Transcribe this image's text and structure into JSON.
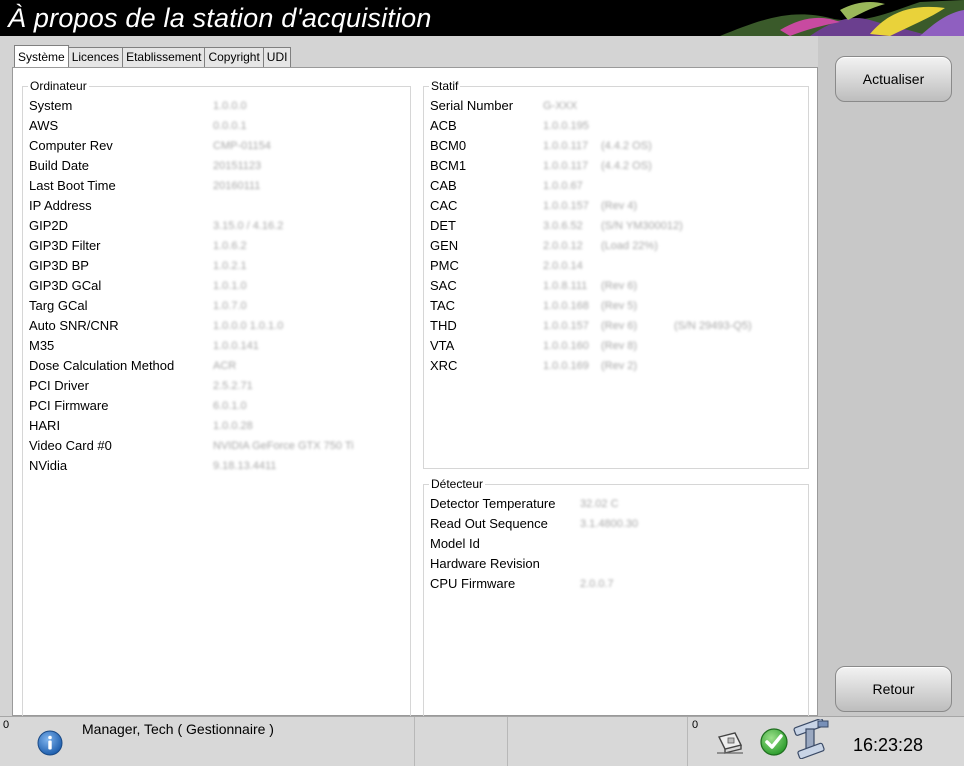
{
  "window": {
    "title": "À propos de la station d'acquisition"
  },
  "tabs": [
    {
      "label": "Système",
      "active": true
    },
    {
      "label": "Licences",
      "active": false
    },
    {
      "label": "Etablissement",
      "active": false
    },
    {
      "label": "Copyright",
      "active": false
    },
    {
      "label": "UDI",
      "active": false
    }
  ],
  "ordinateur": {
    "title": "Ordinateur",
    "rows": [
      {
        "label": "System",
        "value": "1.0.0.0"
      },
      {
        "label": "AWS",
        "value": "0.0.0.1"
      },
      {
        "label": "Computer Rev",
        "value": "CMP-01154"
      },
      {
        "label": "Build Date",
        "value": "20151123"
      },
      {
        "label": "Last Boot Time",
        "value": "20160111"
      },
      {
        "label": "IP Address",
        "value": ""
      },
      {
        "label": "GIP2D",
        "value": "3.15.0 / 4.16.2"
      },
      {
        "label": "GIP3D Filter",
        "value": "1.0.6.2"
      },
      {
        "label": "GIP3D BP",
        "value": "1.0.2.1"
      },
      {
        "label": "GIP3D GCal",
        "value": "1.0.1.0"
      },
      {
        "label": "Targ GCal",
        "value": "1.0.7.0"
      },
      {
        "label": "Auto SNR/CNR",
        "value": "1.0.0.0 1.0.1.0"
      },
      {
        "label": "M35",
        "value": "1.0.0.141"
      },
      {
        "label": "Dose Calculation Method",
        "value": "ACR"
      },
      {
        "label": "PCI Driver",
        "value": "2.5.2.71"
      },
      {
        "label": "PCI Firmware",
        "value": "6.0.1.0"
      },
      {
        "label": "HARI",
        "value": "1.0.0.28"
      },
      {
        "label": "Video Card #0",
        "value": "NVIDIA GeForce GTX 750 Ti"
      },
      {
        "label": "NVidia",
        "value": "9.18.13.4411"
      }
    ]
  },
  "statif": {
    "title": "Statif",
    "rows": [
      {
        "label": "Serial Number",
        "value": "G-XXX",
        "rev": "",
        "sn": ""
      },
      {
        "label": "ACB",
        "value": "1.0.0.195",
        "rev": "",
        "sn": ""
      },
      {
        "label": "BCM0",
        "value": "1.0.0.117",
        "rev": "(4.4.2 OS)",
        "sn": ""
      },
      {
        "label": "BCM1",
        "value": "1.0.0.117",
        "rev": "(4.4.2 OS)",
        "sn": ""
      },
      {
        "label": "CAB",
        "value": "1.0.0.67",
        "rev": "",
        "sn": ""
      },
      {
        "label": "CAC",
        "value": "1.0.0.157",
        "rev": "(Rev 4)",
        "sn": ""
      },
      {
        "label": "DET",
        "value": "3.0.6.52",
        "rev": "(S/N YM300012)",
        "sn": ""
      },
      {
        "label": "GEN",
        "value": "2.0.0.12",
        "rev": "(Load 22%)",
        "sn": ""
      },
      {
        "label": "PMC",
        "value": "2.0.0.14",
        "rev": "",
        "sn": ""
      },
      {
        "label": "SAC",
        "value": "1.0.8.111",
        "rev": "(Rev 6)",
        "sn": ""
      },
      {
        "label": "TAC",
        "value": "1.0.0.168",
        "rev": "(Rev 5)",
        "sn": ""
      },
      {
        "label": "THD",
        "value": "1.0.0.157",
        "rev": "(Rev 6)",
        "sn": "(S/N 29493-Q5)"
      },
      {
        "label": "VTA",
        "value": "1.0.0.160",
        "rev": "(Rev 8)",
        "sn": ""
      },
      {
        "label": "XRC",
        "value": "1.0.0.169",
        "rev": "(Rev 2)",
        "sn": ""
      }
    ]
  },
  "detecteur": {
    "title": "Détecteur",
    "rows": [
      {
        "label": "Detector Temperature",
        "value": "32.02 C"
      },
      {
        "label": "Read Out Sequence",
        "value": "3.1.4800.30"
      },
      {
        "label": "Model Id",
        "value": ""
      },
      {
        "label": "Hardware Revision",
        "value": ""
      },
      {
        "label": "CPU Firmware",
        "value": "2.0.0.7"
      }
    ]
  },
  "buttons": {
    "refresh": "Actualiser",
    "back": "Retour"
  },
  "statusbar": {
    "count_left": "0",
    "user": "Manager, Tech ( Gestionnaire )",
    "count_right": "0",
    "time": "16:23:28"
  },
  "colors": {
    "titlebar": "#000000",
    "panel": "#c8c8c8",
    "status_ok": "#2e9e2e",
    "info_blue": "#1f5fae"
  },
  "icons": [
    "info-icon",
    "cassette-icon",
    "check-icon",
    "gantry-icon"
  ]
}
